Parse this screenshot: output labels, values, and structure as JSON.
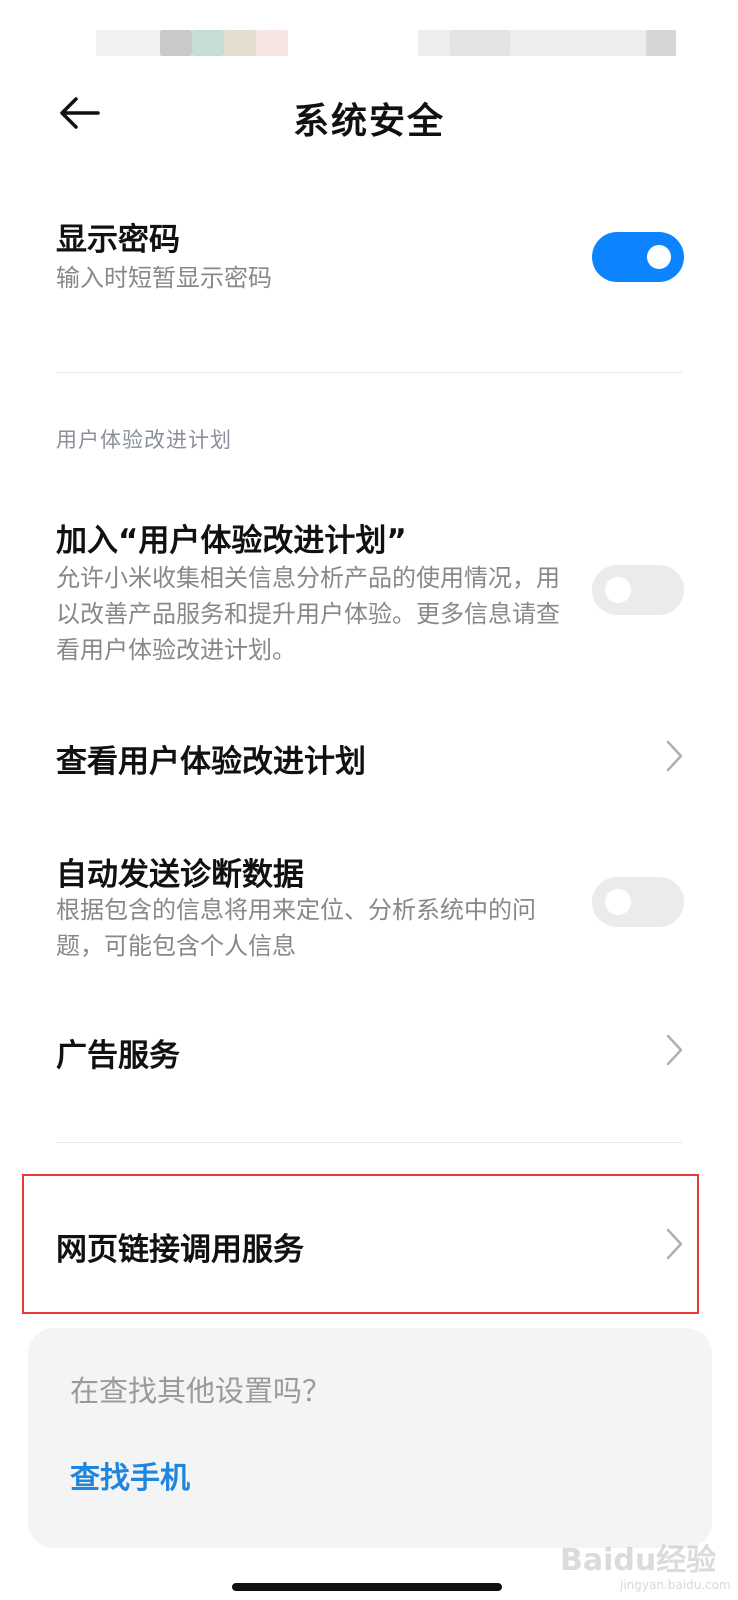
{
  "header": {
    "title": "系统安全"
  },
  "rows": {
    "show_password": {
      "title": "显示密码",
      "subtitle": "输入时短暂显示密码",
      "toggle_on": true
    },
    "ux_program_join": {
      "title": "加入“用户体验改进计划”",
      "subtitle": "允许小米收集相关信息分析产品的使用情况，用以改善产品服务和提升用户体验。更多信息请查看用户体验改进计划。",
      "toggle_on": false
    },
    "view_ux_program": {
      "title": "查看用户体验改进计划"
    },
    "auto_send_diagnostics": {
      "title": "自动发送诊断数据",
      "subtitle": "根据包含的信息将用来定位、分析系统中的问题，可能包含个人信息",
      "toggle_on": false
    },
    "ad_service": {
      "title": "广告服务"
    },
    "web_link_service": {
      "title": "网页链接调用服务"
    }
  },
  "section_header": "用户体验改进计划",
  "search_card": {
    "prompt": "在查找其他设置吗？",
    "link": "查找手机"
  },
  "watermark": {
    "brand": "Baidu经验",
    "url": "jingyan.baidu.com"
  },
  "colors": {
    "accent": "#0d84ff",
    "link": "#1f86e0",
    "highlight_border": "#e53935",
    "toggle_off": "#ebebeb"
  }
}
